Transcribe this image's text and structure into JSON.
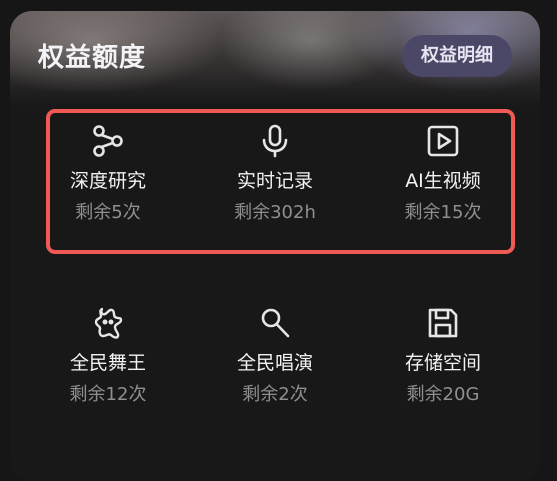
{
  "header": {
    "title": "权益额度",
    "detail_button_label": "权益明细"
  },
  "benefits": [
    {
      "icon": "share-nodes-icon",
      "name": "深度研究",
      "quota": "剩余5次"
    },
    {
      "icon": "microphone-icon",
      "name": "实时记录",
      "quota": "剩余302h"
    },
    {
      "icon": "play-video-icon",
      "name": "AI生视频",
      "quota": "剩余15次"
    },
    {
      "icon": "dancer-icon",
      "name": "全民舞王",
      "quota": "剩余12次"
    },
    {
      "icon": "karaoke-mic-icon",
      "name": "全民唱演",
      "quota": "剩余2次"
    },
    {
      "icon": "save-disk-icon",
      "name": "存储空间",
      "quota": "剩余20G"
    }
  ],
  "colors": {
    "highlight": "#ef5a55",
    "button_bg": "#4b4867",
    "background": "#161616"
  }
}
